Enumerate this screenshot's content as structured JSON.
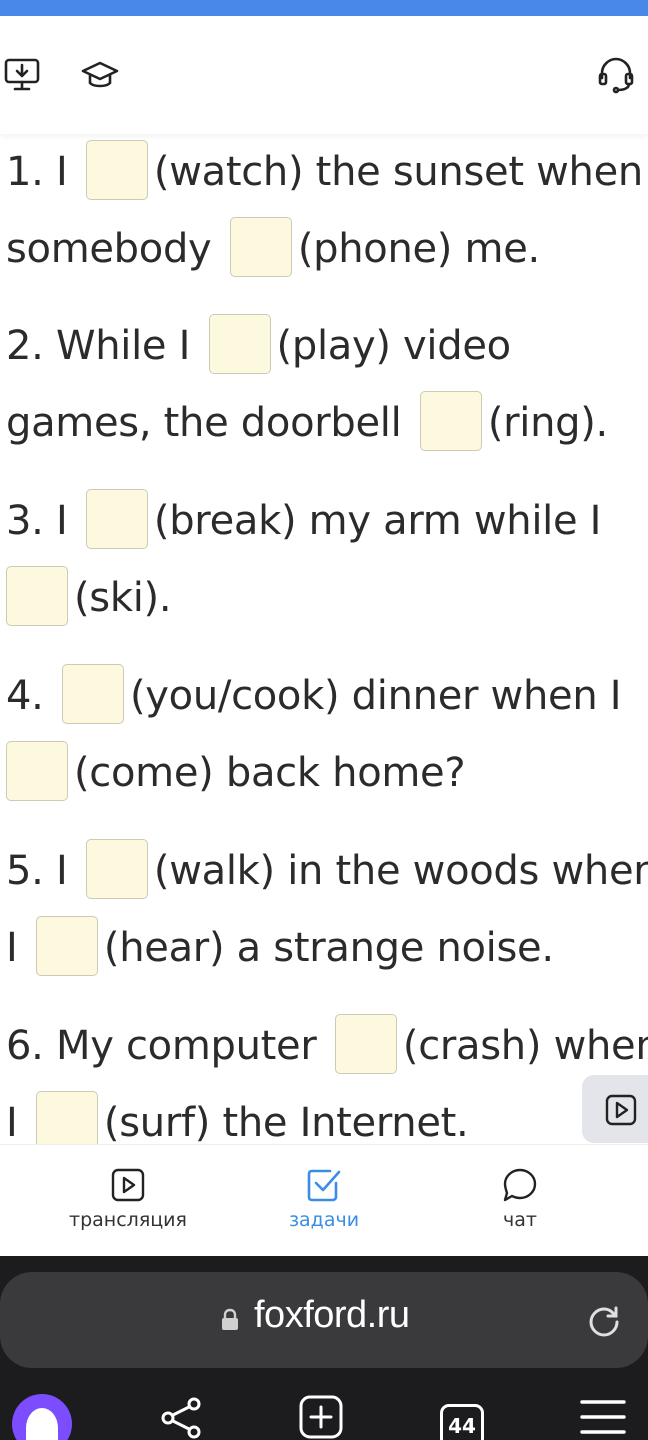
{
  "header": {
    "icons": [
      "download-screen-icon",
      "graduation-cap-icon",
      "headset-icon"
    ]
  },
  "exercise": {
    "questions": [
      {
        "lines": [
          [
            "1. I ",
            "(watch) the sunset when"
          ],
          [
            "somebody ",
            "(phone) me."
          ]
        ]
      },
      {
        "lines": [
          [
            "2. While I ",
            "(play) video"
          ],
          [
            "games, the doorbell ",
            "(ring)."
          ]
        ]
      },
      {
        "lines": [
          [
            "3. I ",
            "(break) my arm while I"
          ],
          [
            "",
            "(ski)."
          ]
        ]
      },
      {
        "lines": [
          [
            "4. ",
            "(you/cook) dinner when I"
          ],
          [
            "",
            "(come) back home?"
          ]
        ]
      },
      {
        "lines": [
          [
            "5. I ",
            "(walk) in the woods when"
          ],
          [
            "I ",
            "(hear) a strange noise."
          ]
        ]
      },
      {
        "lines": [
          [
            "6. My computer ",
            "(crash) when"
          ],
          [
            "I ",
            "(surf) the Internet."
          ]
        ]
      }
    ]
  },
  "bottom_nav": {
    "items": [
      {
        "label": "трансляция",
        "icon": "play-square-icon"
      },
      {
        "label": "задачи",
        "icon": "checkbox-icon",
        "active": true
      },
      {
        "label": "чат",
        "icon": "chat-bubble-icon"
      }
    ],
    "active_color": "#3a8de6"
  },
  "browser": {
    "url": "foxford.ru",
    "tabs_count": "44"
  },
  "colors": {
    "accent_strip": "#4a88e8",
    "blank_fill": "#fdf9df",
    "browser_bg": "#1c1c1e"
  }
}
